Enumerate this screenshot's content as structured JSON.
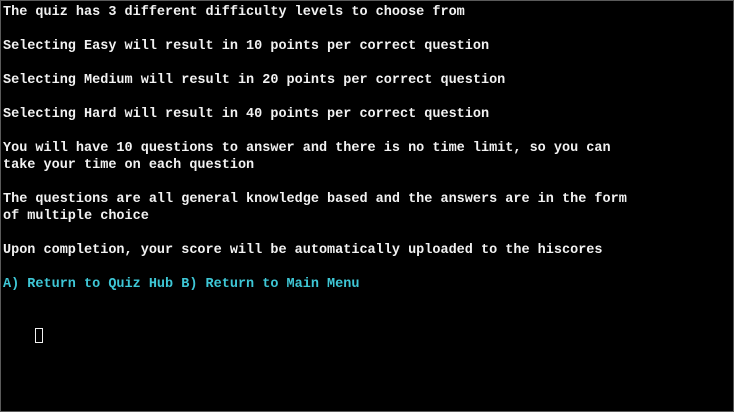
{
  "terminal": {
    "lines": [
      "The quiz has 3 different difficulty levels to choose from",
      "Selecting Easy will result in 10 points per correct question",
      "Selecting Medium will result in 20 points per correct question",
      "Selecting Hard will result in 40 points per correct question",
      "You will have 10 questions to answer and there is no time limit, so you can",
      "take your time on each question",
      "The questions are all general knowledge based and the answers are in the form",
      "of multiple choice",
      "Upon completion, your score will be automatically uploaded to the hiscores"
    ],
    "menu_line": "A) Return to Quiz Hub B) Return to Main Menu"
  },
  "colors": {
    "background": "#000000",
    "text": "#f2f2f2",
    "menu_text": "#3ec7d6"
  }
}
